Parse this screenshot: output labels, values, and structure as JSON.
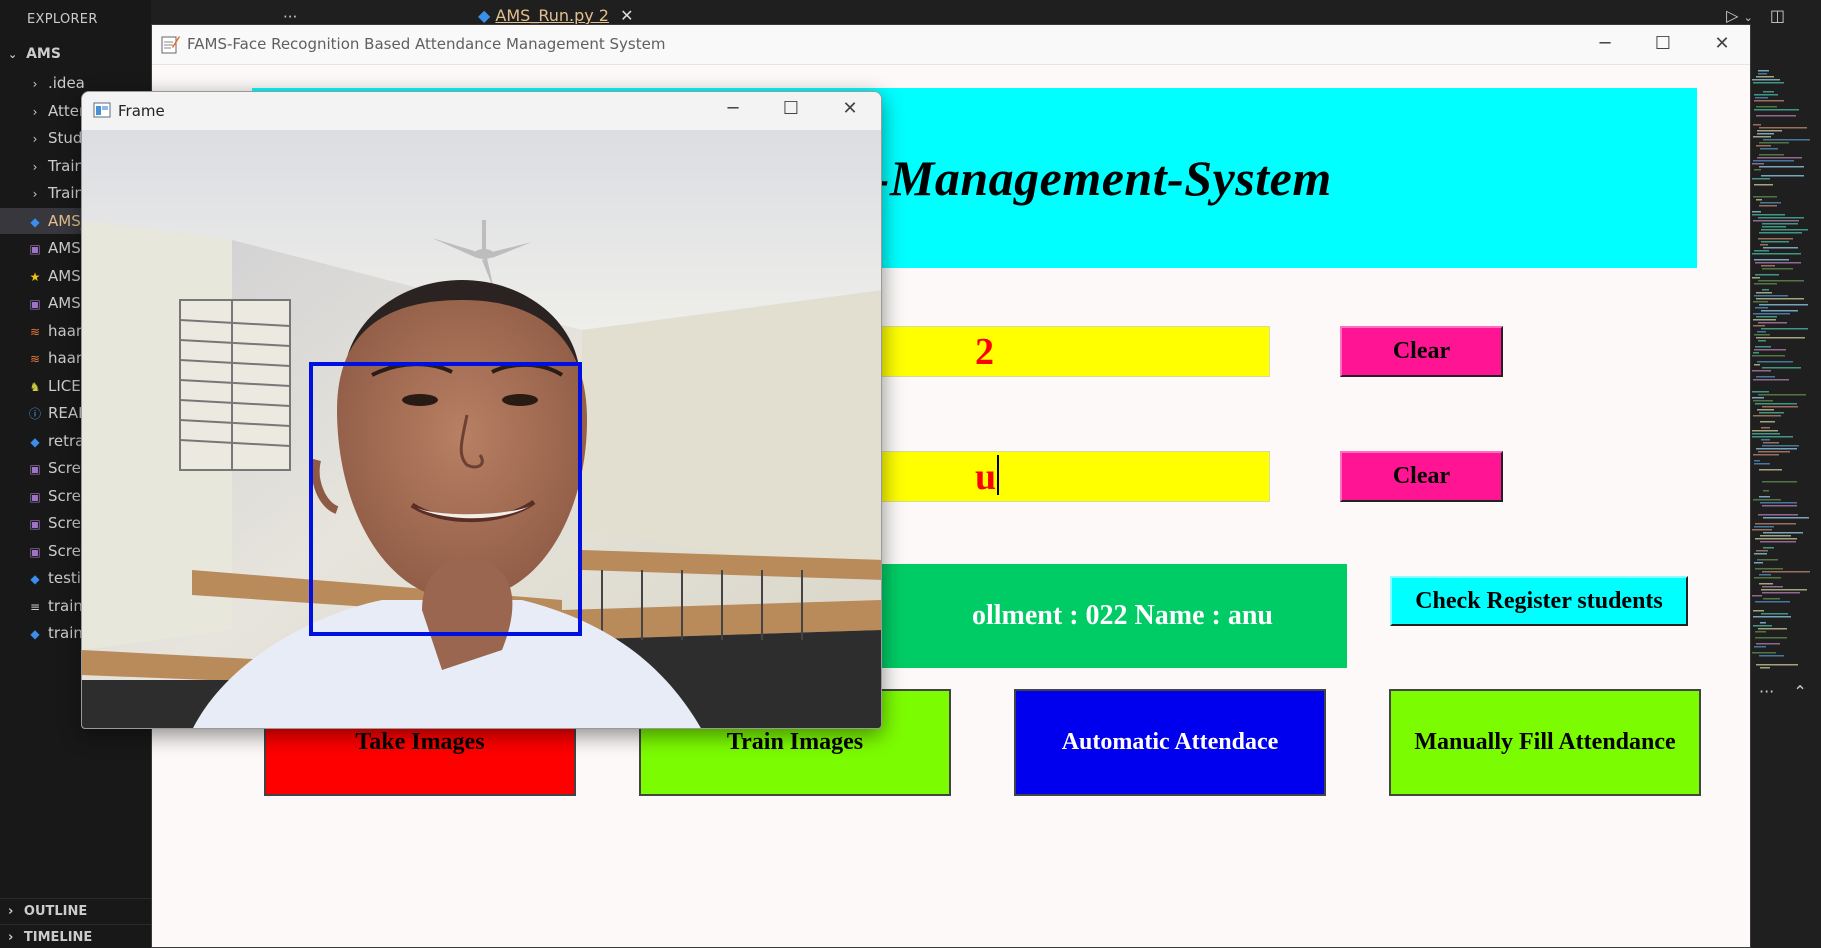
{
  "vscode": {
    "explorer_header": "EXPLORER",
    "more": "···",
    "root": "AMS",
    "items": [
      {
        "icon": "chevron-right-icon",
        "label": ".idea"
      },
      {
        "icon": "chevron-right-icon",
        "label": "Atten"
      },
      {
        "icon": "chevron-right-icon",
        "label": "Stude"
      },
      {
        "icon": "chevron-right-icon",
        "label": "Traini"
      },
      {
        "icon": "chevron-right-icon",
        "label": "Traini"
      },
      {
        "icon": "python-icon",
        "label": "AMS_"
      },
      {
        "icon": "image-icon",
        "label": "AMS."
      },
      {
        "icon": "star-icon",
        "label": "AMS."
      },
      {
        "icon": "image-icon",
        "label": "AMS."
      },
      {
        "icon": "rss-icon",
        "label": "haarc"
      },
      {
        "icon": "rss-icon",
        "label": "haarc"
      },
      {
        "icon": "license-icon",
        "label": "LICEN"
      },
      {
        "icon": "info-icon",
        "label": "READ"
      },
      {
        "icon": "python-icon",
        "label": "retrai"
      },
      {
        "icon": "image-icon",
        "label": "Scree"
      },
      {
        "icon": "image-icon",
        "label": "Scree"
      },
      {
        "icon": "image-icon",
        "label": "Scree"
      },
      {
        "icon": "image-icon",
        "label": "Scree"
      },
      {
        "icon": "python-icon",
        "label": "testin"
      },
      {
        "icon": "list-icon",
        "label": "traini"
      },
      {
        "icon": "python-icon",
        "label": "traini"
      }
    ],
    "outline": "OUTLINE",
    "timeline": "TIMELINE",
    "tab_label": "AMS_Run.py 2",
    "editor_more": "···"
  },
  "fams": {
    "window_title": "FAMS-Face Recognition Based Attendance Management System",
    "banner_text": "-Attendance-Management-System",
    "enrollment_value": "2",
    "name_value": "u",
    "clear_label_1": "Clear",
    "clear_label_2": "Clear",
    "message": "ollment : 022 Name : anu",
    "check_register_label": "Check Register students",
    "take_images_label": "Take Images",
    "train_images_label": "Train Images",
    "automatic_label": "Automatic Attendace",
    "manual_label": "Manually Fill Attendance",
    "colors": {
      "banner": "#00ffff",
      "entry": "#ffff00",
      "clear": "#ff1493",
      "message": "#00cc66",
      "take": "#ff0000",
      "train": "#7cfc00",
      "automatic": "#0000ee",
      "manual": "#7cfc00"
    }
  },
  "frame": {
    "title": "Frame"
  }
}
